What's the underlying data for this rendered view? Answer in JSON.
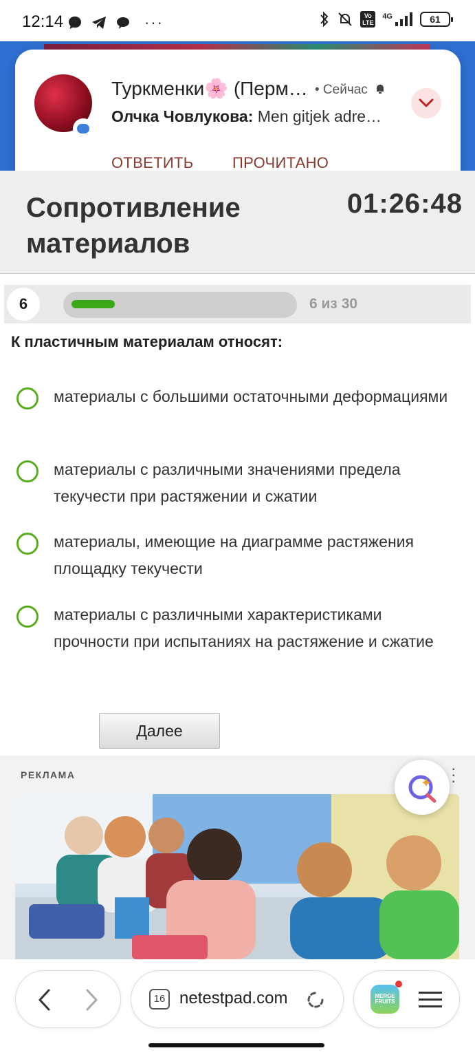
{
  "status_bar": {
    "time": "12:14",
    "left_icons": [
      "chat-bubble-icon",
      "telegram-icon",
      "message-icon",
      "more-dots-icon"
    ],
    "more": "···",
    "right_icons": [
      "bluetooth-icon",
      "mute-icon",
      "volte-icon",
      "signal-icon"
    ],
    "network": "4G",
    "volte": "Vo LTE",
    "battery": "61"
  },
  "notification": {
    "title": "Туркменки🌸 (Перм…",
    "time": "• Сейчас",
    "sender": "Олчка Човлукова:",
    "message": " Men gitjek adre…",
    "actions": [
      "ОТВЕТИТЬ",
      "ПРОЧИТАНО"
    ]
  },
  "header": {
    "title": "Сопротивление материалов",
    "timer": "01:26:48"
  },
  "progress": {
    "question_number": "6",
    "label": "6 из 30",
    "fraction": 0.2
  },
  "question": {
    "text": "К пластичным материалам относят:",
    "options": [
      "материалы с большими остаточными деформациями",
      "материалы с различными значениями предела текучести при растяжении и сжатии",
      "материалы, имеющие на диаграмме растяжения площадку текучести",
      "материалы с различными характеристиками прочности при испытаниях на растяжение и сжатие"
    ]
  },
  "next_button": "Далее",
  "ad": {
    "label": "РЕКЛАМА"
  },
  "browser": {
    "tab_count": "16",
    "url": "netestpad.com",
    "app_icon_text": "MERGE FRUITS"
  },
  "colors": {
    "accent_green": "#5aac1c",
    "progress_green": "#3aa818",
    "header_blue": "#2e6fd1",
    "action_brown": "#8a3a2f"
  }
}
